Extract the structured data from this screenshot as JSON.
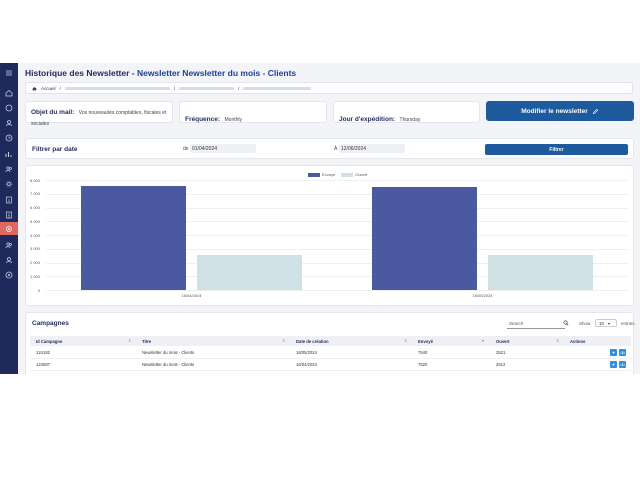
{
  "header": {
    "title_prefix": "Historique des Newsletter",
    "title_separator": " - ",
    "title_accent": "Newsletter Newsletter du mois - Clients"
  },
  "breadcrumb": {
    "home": "Accueil",
    "separator": "/"
  },
  "info": {
    "subject_label": "Objet du mail:",
    "subject_value": "Vos nouveautés comptables, fiscales et sociales",
    "frequency_label": "Fréquence:",
    "frequency_value": "Monthly",
    "day_label": "Jour d'expédition:",
    "day_value": "Thursday",
    "edit_button": "Modifier le newsletter"
  },
  "filter": {
    "title": "Filtrer par date",
    "from_prefix": "de",
    "from_value": "01/04/2024",
    "to_prefix": "À",
    "to_value": "12/06/2024",
    "button": "Filtrer"
  },
  "chart_data": {
    "type": "bar",
    "categories": [
      "16/04/2024",
      "16/05/2024"
    ],
    "series": [
      {
        "name": "Envoyé",
        "values": [
          7540,
          7520
        ],
        "color": "#4b5aa0"
      },
      {
        "name": "Ouvert",
        "values": [
          2521,
          2512
        ],
        "color": "#cfe1e4"
      }
    ],
    "ylim": [
      0,
      8000
    ],
    "yticks": [
      "8 000",
      "7 000",
      "6 000",
      "5 000",
      "4 000",
      "3 000",
      "2 000",
      "1 000",
      "0"
    ],
    "legend": "top-center",
    "grid": true
  },
  "table": {
    "title": "Campagnes",
    "search_placeholder": "Search",
    "show_label": "Show",
    "show_value": "10",
    "entries_label": "entries",
    "columns": [
      "Id Campagne",
      "Titre",
      "Date de création",
      "Envoyé",
      "Ouvert",
      "Actions"
    ],
    "rows": [
      {
        "id": "124182",
        "titre": "Newsletter du mois - Clients",
        "date": "16/05/2024",
        "envoye": "7540",
        "ouvert": "2521"
      },
      {
        "id": "123687",
        "titre": "Newsletter du mois - Clients",
        "date": "16/04/2024",
        "envoye": "7520",
        "ouvert": "2512"
      }
    ]
  },
  "colors": {
    "sidebar": "#1f2a5c",
    "accent": "#1d5a9e",
    "active": "#e0685d"
  }
}
